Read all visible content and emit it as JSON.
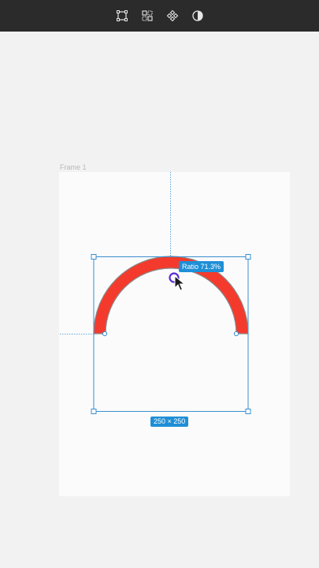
{
  "toolbar": {
    "tools": [
      {
        "icon": "frame-tool-icon"
      },
      {
        "icon": "component-grid-icon"
      },
      {
        "icon": "component-diamond-icon"
      },
      {
        "icon": "contrast-half-icon"
      }
    ]
  },
  "canvas": {
    "frame_label": "Frame 1",
    "shape": {
      "type": "arc",
      "fill_color": "#f43a2c",
      "stroke_color": "#8a8a8a",
      "ratio_label": "Ratio 71.3%",
      "size_label": "250 × 250"
    },
    "selection_color": "#1e8fd6"
  }
}
